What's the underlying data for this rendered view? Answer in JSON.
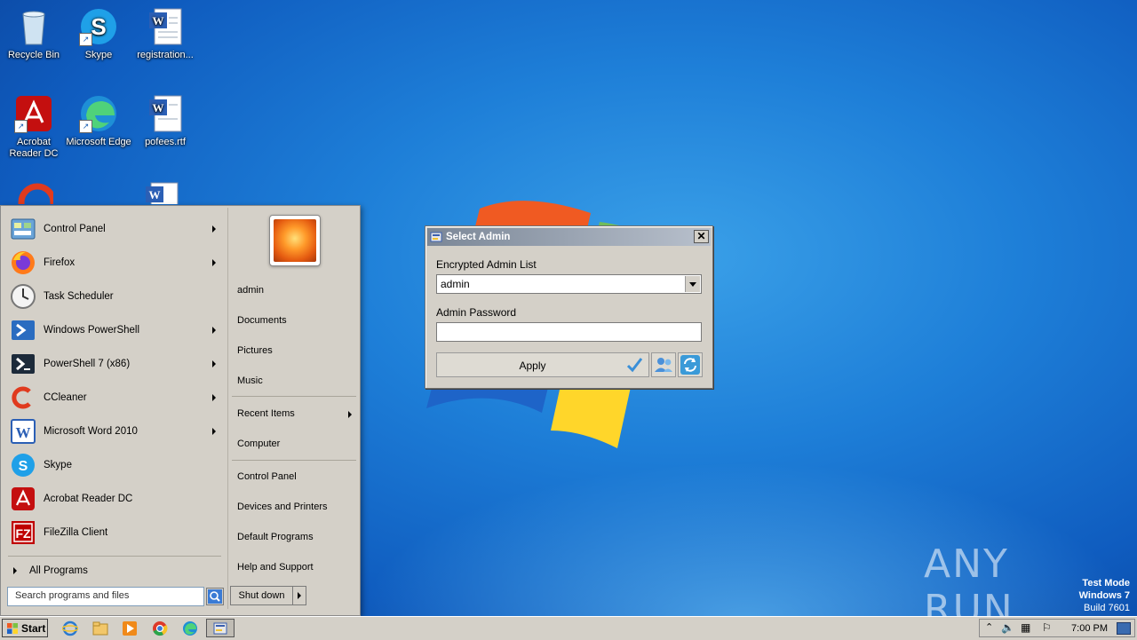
{
  "desktop": {
    "icons": [
      {
        "label": "Recycle Bin"
      },
      {
        "label": "Skype"
      },
      {
        "label": "registration..."
      },
      {
        "label": "Acrobat Reader DC"
      },
      {
        "label": "Microsoft Edge"
      },
      {
        "label": "pofees.rtf"
      }
    ]
  },
  "start_menu": {
    "programs": [
      {
        "label": "Control Panel",
        "submenu": true
      },
      {
        "label": "Firefox",
        "submenu": true
      },
      {
        "label": "Task Scheduler",
        "submenu": false
      },
      {
        "label": "Windows PowerShell",
        "submenu": true
      },
      {
        "label": "PowerShell 7 (x86)",
        "submenu": true
      },
      {
        "label": "CCleaner",
        "submenu": true
      },
      {
        "label": "Microsoft Word 2010",
        "submenu": true
      },
      {
        "label": "Skype",
        "submenu": false
      },
      {
        "label": "Acrobat Reader DC",
        "submenu": false
      },
      {
        "label": "FileZilla Client",
        "submenu": false
      }
    ],
    "all_programs": "All Programs",
    "search_placeholder": "Search programs and files",
    "right_links": [
      {
        "label": "admin"
      },
      {
        "label": "Documents"
      },
      {
        "label": "Pictures"
      },
      {
        "label": "Music"
      },
      {
        "label": "Recent Items"
      },
      {
        "label": "Computer"
      },
      {
        "label": "Control Panel"
      },
      {
        "label": "Devices and Printers"
      },
      {
        "label": "Default Programs"
      },
      {
        "label": "Help and Support"
      }
    ],
    "shutdown": "Shut down"
  },
  "dialog": {
    "title": "Select Admin",
    "list_label": "Encrypted Admin List",
    "list_value": "admin",
    "password_label": "Admin Password",
    "password_value": "",
    "apply": "Apply",
    "close": "✕"
  },
  "taskbar": {
    "start": "Start",
    "clock": "7:00 PM"
  },
  "watermark": {
    "brand": "ANY RUN",
    "line1": "Test Mode",
    "line2": "Windows 7",
    "line3": "Build 7601"
  }
}
